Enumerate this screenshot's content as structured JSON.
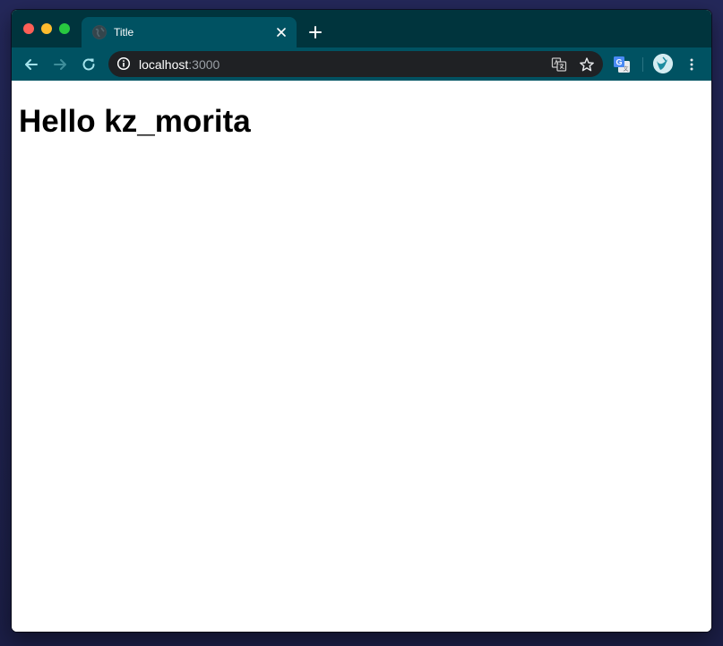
{
  "browser": {
    "tab": {
      "title": "Title",
      "favicon": "globe-icon"
    },
    "new_tab": "plus-icon",
    "nav": {
      "back": "arrow-left-icon",
      "forward": "arrow-right-icon",
      "reload": "reload-icon"
    },
    "address": {
      "host": "localhost",
      "port": ":3000",
      "security": "info-icon"
    },
    "omnibox_actions": [
      "translate-icon",
      "star-icon"
    ],
    "extensions": [
      "google-translate-icon"
    ],
    "profile": "avatar",
    "menu": "more-vert-icon",
    "colors": {
      "frame": "#00343d",
      "toolbar": "#005262",
      "omnibox": "#1f2124",
      "icon": "#a4e3ec"
    }
  },
  "page": {
    "heading": "Hello kz_morita"
  }
}
